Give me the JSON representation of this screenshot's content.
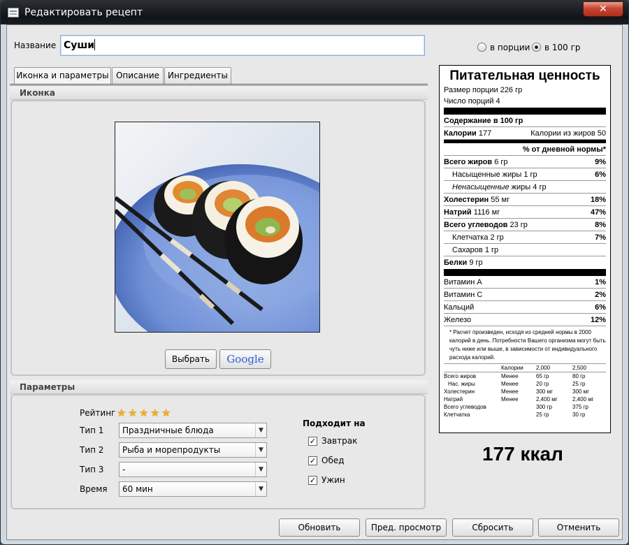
{
  "window": {
    "title": "Редактировать рецепт",
    "close": "✕"
  },
  "name_label": "Название",
  "name_value": "Суши",
  "portion_mode": {
    "per_portion": "в порции",
    "per_100g": "в 100 гр",
    "selected": "per_100g"
  },
  "tabs": [
    "Иконка и параметры",
    "Описание",
    "Ингредиенты"
  ],
  "icon_section": {
    "title": "Иконка",
    "choose_button": "Выбрать",
    "google_button": "Google"
  },
  "params": {
    "title": "Параметры",
    "rating_label": "Рейтинг",
    "rating": 5,
    "type1_label": "Тип 1",
    "type1_value": "Праздничные блюда",
    "type2_label": "Тип 2",
    "type2_value": "Рыба и морепродукты",
    "type3_label": "Тип 3",
    "type3_value": "-",
    "time_label": "Время",
    "time_value": "60 мин",
    "suitable_label": "Подходит на",
    "meals": [
      {
        "label": "Завтрак",
        "checked": true
      },
      {
        "label": "Обед",
        "checked": true
      },
      {
        "label": "Ужин",
        "checked": true
      }
    ]
  },
  "nutrition": {
    "title": "Питательная ценность",
    "serving_size": "Размер порции 226 гр",
    "servings": "Число порций 4",
    "content_per": "Содержание в 100 гр",
    "calories_label": "Калории",
    "calories_value": "177",
    "fat_calories": "Калории из жиров 50",
    "dv_header": "% от дневной нормы*",
    "fat": {
      "label": "Всего жиров",
      "value": "6 гр",
      "dv": "9%"
    },
    "sat_fat": {
      "label": "Насыщенные жиры 1 гр",
      "dv": "6%"
    },
    "unsat_fat": {
      "label_italic": "Ненасыщенные",
      "label_rest": " жиры 4 гр"
    },
    "chol": {
      "label": "Холестерин",
      "value": "55 мг",
      "dv": "18%"
    },
    "sodium": {
      "label": "Натрий",
      "value": "1116 мг",
      "dv": "47%"
    },
    "carbs": {
      "label": "Всего углеводов",
      "value": "23 гр",
      "dv": "8%"
    },
    "fiber": {
      "label": "Клетчатка 2 гр",
      "dv": "7%"
    },
    "sugar": {
      "label": "Сахаров 1 гр"
    },
    "protein": {
      "label": "Белки",
      "value": "9 гр"
    },
    "vitA": {
      "label": "Витамин А",
      "dv": "1%"
    },
    "vitC": {
      "label": "Витамин С",
      "dv": "2%"
    },
    "calcium": {
      "label": "Кальций",
      "dv": "6%"
    },
    "iron": {
      "label": "Железо",
      "dv": "12%"
    },
    "footnote": "* Расчет произведен, исходя из средней нормы в 2000 калорий в день. Потребности Вашего организма могут быть чуть ниже или выше, в зависимости от индивидуального расхода калорий.",
    "table_header": [
      "",
      "Калории",
      "2,000",
      "2,500"
    ],
    "table_rows": [
      [
        "Всего жиров",
        "Менее",
        "65 гр",
        "80 гр"
      ],
      [
        "  Нас. жиры",
        "Менее",
        "20 гр",
        "25 гр"
      ],
      [
        "Холестерин",
        "Менее",
        "300 мг",
        "300 мг"
      ],
      [
        "Натрий",
        "Менее",
        "2,400 мг",
        "2,400 мг"
      ],
      [
        "Всего углеводов",
        "",
        "300 гр",
        "375 гр"
      ],
      [
        "Клетчатка",
        "",
        "25 гр",
        "30 гр"
      ]
    ]
  },
  "kcal": "177 ккал",
  "buttons": {
    "update": "Обновить",
    "preview": "Пред. просмотр",
    "reset": "Сбросить",
    "cancel": "Отменить"
  }
}
